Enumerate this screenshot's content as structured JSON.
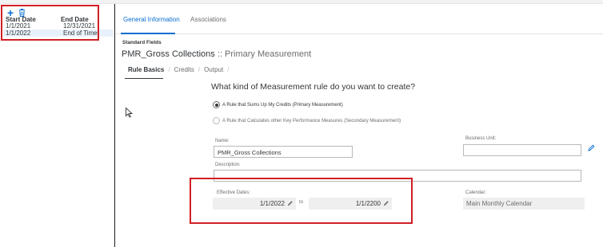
{
  "left_panel": {
    "headers": {
      "start_date": "Start Date",
      "end_date": "End Date"
    },
    "rows": [
      {
        "start": "1/1/2021",
        "end": "12/31/2021"
      },
      {
        "start": "1/1/2022",
        "end": "End of Time"
      }
    ],
    "icons": {
      "add": "plus-icon",
      "delete": "trash-icon"
    }
  },
  "tabs": [
    {
      "label": "General Information",
      "active": true
    },
    {
      "label": "Associations",
      "active": false
    }
  ],
  "section": {
    "title": "Standard Fields"
  },
  "rule": {
    "name": "PMR_Gross Collections",
    "separator": " :: ",
    "type": "Primary Measurement"
  },
  "subtabs": [
    {
      "label": "Rule Basics",
      "active": true
    },
    {
      "label": "Credits",
      "active": false
    },
    {
      "label": "Output",
      "active": false
    }
  ],
  "question": "What kind of Measurement rule do you want to create?",
  "options": [
    {
      "label": "A Rule that Sums Up My Credits (Primary Measurement)",
      "selected": true
    },
    {
      "label": "A Rule that Calculates other Key Performance Measures (Secondary Measurement)",
      "selected": false
    }
  ],
  "form": {
    "name_label": "Name:",
    "name_value": "PMR_Gross Collections",
    "business_unit_label": "Business Unit:",
    "business_unit_value": "",
    "description_label": "Description:",
    "description_value": "",
    "effective_dates_label": "Effective Dates:",
    "effective_from": "1/1/2022",
    "to_label": "to",
    "effective_to": "1/1/2200",
    "calendar_label": "Calendar:",
    "calendar_value": "Main Monthly Calendar"
  },
  "colors": {
    "accent": "#0a6ed1",
    "highlight_box": "#d11f25",
    "selected_row": "#e8f1fb"
  }
}
